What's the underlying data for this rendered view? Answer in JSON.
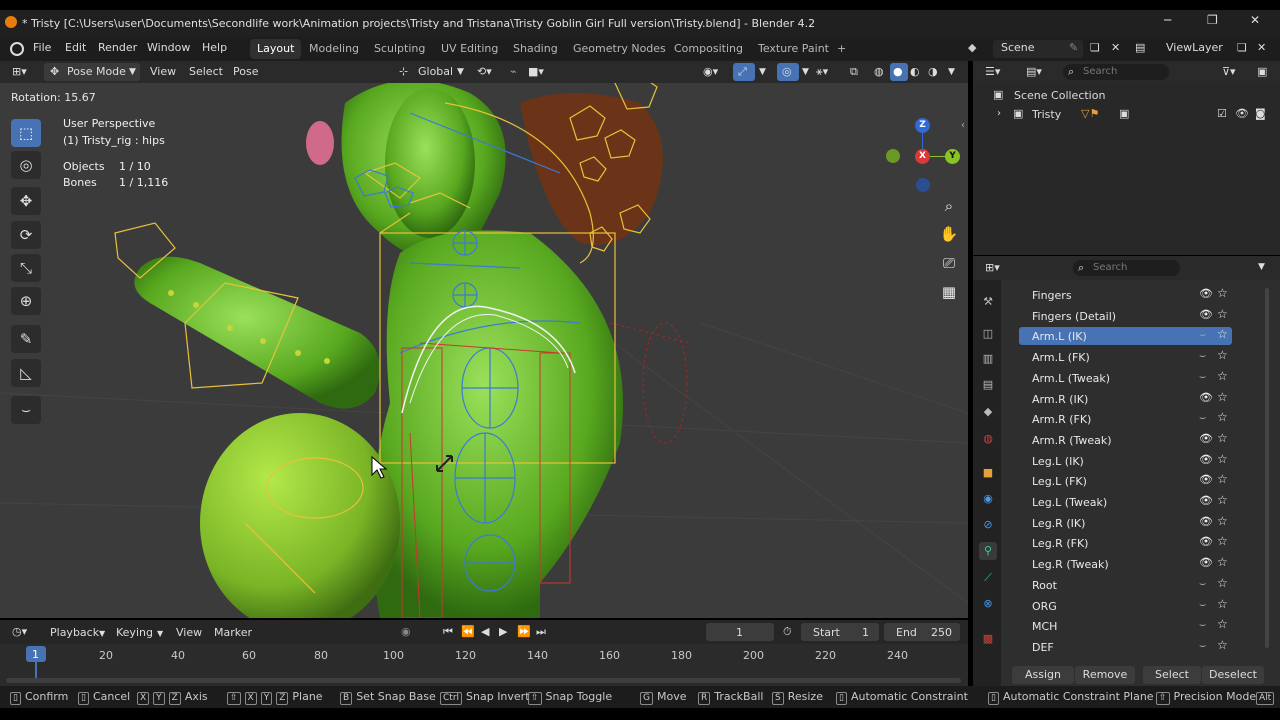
{
  "window": {
    "title": "* Tristy [C:\\Users\\user\\Documents\\Secondlife work\\Animation projects\\Tristy and Tristana\\Tristy Goblin Girl Full version\\Tristy.blend] - Blender 4.2",
    "minimize": "─",
    "maximize": "❐",
    "close": "✕"
  },
  "menubar": {
    "items": [
      "File",
      "Edit",
      "Render",
      "Window",
      "Help"
    ],
    "workspaces": [
      "Layout",
      "Modeling",
      "Sculpting",
      "UV Editing",
      "Shading",
      "Geometry Nodes",
      "Compositing",
      "Texture Paint"
    ],
    "add_tab": "+",
    "scene_label": "Scene",
    "viewlayer_label": "ViewLayer"
  },
  "viewport_header": {
    "mode": "Pose Mode",
    "view": "View",
    "select": "Select",
    "pose": "Pose",
    "orientation": "Global"
  },
  "viewport": {
    "operator_status": "Rotation: 15.67",
    "perspective": "User Perspective",
    "active_object": "(1) Tristy_rig : hips",
    "objects_label": "Objects",
    "objects_value": "1 / 10",
    "bones_label": "Bones",
    "bones_value": "1 / 1,116",
    "gizmo": {
      "z": "Z",
      "x": "X",
      "y": "Y"
    }
  },
  "timeline": {
    "playback": "Playback",
    "keying": "Keying",
    "view": "View",
    "marker": "Marker",
    "current_frame": "1",
    "start_label": "Start",
    "start_value": "1",
    "end_label": "End",
    "end_value": "250",
    "ticks": [
      "20",
      "40",
      "60",
      "80",
      "100",
      "120",
      "140",
      "160",
      "180",
      "200",
      "220",
      "240"
    ],
    "cursor_frame": "1"
  },
  "statusbar": {
    "items": [
      {
        "keys": [],
        "label": "Confirm"
      },
      {
        "keys": [],
        "label": "Cancel"
      },
      {
        "keys": [
          "X",
          "Y",
          "Z"
        ],
        "label": "Axis"
      },
      {
        "keys": [
          "⇧",
          "X",
          "Y",
          "Z"
        ],
        "label": "Plane"
      },
      {
        "keys": [
          "B"
        ],
        "label": "Set Snap Base"
      },
      {
        "keys": [
          "Ctrl"
        ],
        "label": "Snap Invert"
      },
      {
        "keys": [
          "⇧"
        ],
        "label": "Snap Toggle"
      },
      {
        "keys": [
          "G"
        ],
        "label": "Move"
      },
      {
        "keys": [
          "R"
        ],
        "label": "TrackBall"
      },
      {
        "keys": [
          "S"
        ],
        "label": "Resize"
      },
      {
        "keys": [],
        "label": "Automatic Constraint"
      },
      {
        "keys": [],
        "label": "Automatic Constraint Plane"
      },
      {
        "keys": [],
        "label": "Precision Mode"
      }
    ],
    "tail": "Alt"
  },
  "outliner": {
    "search_placeholder": "Search",
    "scene_collection": "Scene Collection",
    "item": "Tristy"
  },
  "properties": {
    "search_placeholder": "Search",
    "bone_collections": [
      {
        "name": "Fingers",
        "visible": true,
        "selected": false
      },
      {
        "name": "Fingers (Detail)",
        "visible": true,
        "selected": false
      },
      {
        "name": "Arm.L (IK)",
        "visible": false,
        "selected": true
      },
      {
        "name": "Arm.L (FK)",
        "visible": false,
        "selected": false
      },
      {
        "name": "Arm.L (Tweak)",
        "visible": false,
        "selected": false
      },
      {
        "name": "Arm.R (IK)",
        "visible": true,
        "selected": false
      },
      {
        "name": "Arm.R (FK)",
        "visible": false,
        "selected": false
      },
      {
        "name": "Arm.R (Tweak)",
        "visible": true,
        "selected": false
      },
      {
        "name": "Leg.L (IK)",
        "visible": true,
        "selected": false
      },
      {
        "name": "Leg.L (FK)",
        "visible": true,
        "selected": false
      },
      {
        "name": "Leg.L (Tweak)",
        "visible": true,
        "selected": false
      },
      {
        "name": "Leg.R (IK)",
        "visible": true,
        "selected": false
      },
      {
        "name": "Leg.R (FK)",
        "visible": true,
        "selected": false
      },
      {
        "name": "Leg.R (Tweak)",
        "visible": true,
        "selected": false
      },
      {
        "name": "Root",
        "visible": false,
        "selected": false
      },
      {
        "name": "ORG",
        "visible": false,
        "selected": false
      },
      {
        "name": "MCH",
        "visible": false,
        "selected": false
      },
      {
        "name": "DEF",
        "visible": false,
        "selected": false
      }
    ],
    "buttons": {
      "assign": "Assign",
      "remove": "Remove",
      "select": "Select",
      "deselect": "Deselect"
    }
  },
  "colors": {
    "accent": "#4772b3",
    "bone_yellow": "#e8c23a",
    "bone_blue": "#3a7ad8",
    "mesh_green": "#6fbf2a"
  }
}
